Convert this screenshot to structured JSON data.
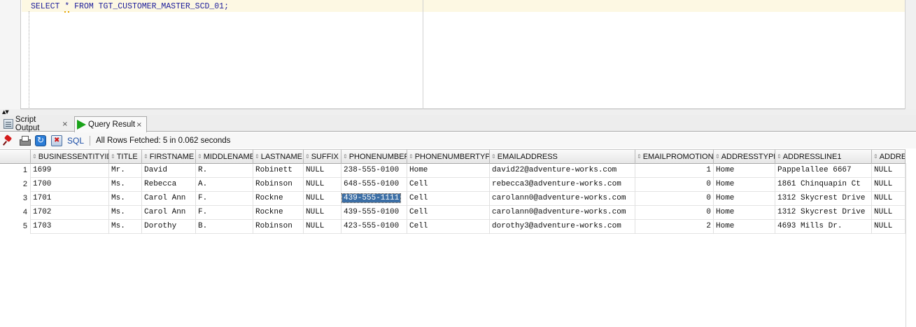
{
  "editor": {
    "sql_keyword_select": "SELECT",
    "sql_star": "*",
    "sql_keyword_from": "FROM",
    "sql_table": "TGT_CUSTOMER_MASTER_SCD_01;"
  },
  "tabs": [
    {
      "label": "Script Output",
      "close": "×",
      "icon": "script-output-icon"
    },
    {
      "label": "Query Result",
      "close": "×",
      "icon": "play-icon"
    }
  ],
  "toolbar": {
    "sql_label": "SQL",
    "status": "All Rows Fetched: 5 in 0.062 seconds",
    "icons": [
      "pin-icon",
      "print-icon",
      "refresh-icon",
      "delete-icon"
    ]
  },
  "grid": {
    "columns": [
      "BUSINESSENTITYID",
      "TITLE",
      "FIRSTNAME",
      "MIDDLENAME",
      "LASTNAME",
      "SUFFIX",
      "PHONENUMBER",
      "PHONENUMBERTYPE",
      "EMAILADDRESS",
      "EMAILPROMOTION",
      "ADDRESSTYPE",
      "ADDRESSLINE1",
      "ADDRE"
    ],
    "rows": [
      {
        "rn": "1",
        "cells": [
          "1699",
          "Mr.",
          "David",
          "R.",
          "Robinett",
          "NULL",
          "238-555-0100",
          "Home",
          "david22@adventure-works.com",
          "1",
          "Home",
          "Pappelallee 6667",
          "NULL"
        ]
      },
      {
        "rn": "2",
        "cells": [
          "1700",
          "Ms.",
          "Rebecca",
          "A.",
          "Robinson",
          "NULL",
          "648-555-0100",
          "Cell",
          "rebecca3@adventure-works.com",
          "0",
          "Home",
          "1861 Chinquapin Ct",
          "NULL"
        ]
      },
      {
        "rn": "3",
        "cells": [
          "1701",
          "Ms.",
          "Carol Ann",
          "F.",
          "Rockne",
          "NULL",
          "439-555-1111",
          "Cell",
          "carolann0@adventure-works.com",
          "0",
          "Home",
          "1312 Skycrest Drive",
          "NULL"
        ]
      },
      {
        "rn": "4",
        "cells": [
          "1702",
          "Ms.",
          "Carol Ann",
          "F.",
          "Rockne",
          "NULL",
          "439-555-0100",
          "Cell",
          "carolann0@adventure-works.com",
          "0",
          "Home",
          "1312 Skycrest Drive",
          "NULL"
        ]
      },
      {
        "rn": "5",
        "cells": [
          "1703",
          "Ms.",
          "Dorothy",
          "B.",
          "Robinson",
          "NULL",
          "423-555-0100",
          "Cell",
          "dorothy3@adventure-works.com",
          "2",
          "Home",
          "4693 Mills Dr.",
          "NULL"
        ]
      }
    ],
    "selected_cell": {
      "row": 2,
      "col": 6
    }
  }
}
